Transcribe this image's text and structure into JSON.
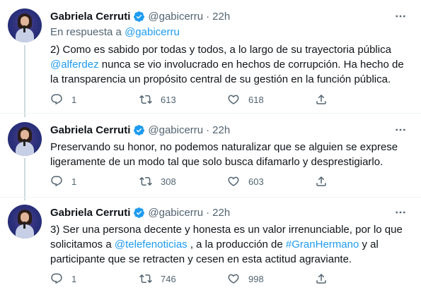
{
  "author": {
    "name": "Gabriela Cerruti",
    "handle": "@gabicerru",
    "time": "22h"
  },
  "colors": {
    "link": "#1d9bf0",
    "muted": "#536471",
    "verified": "#1d9bf0"
  },
  "tweets": [
    {
      "reply_prefix": "En respuesta a ",
      "reply_handle": "@gabicerru",
      "text_a": "2) Como es sabido por todas y todos, a lo largo de su trayectoria pública",
      "mention": "@alferdez",
      "text_b": " nunca se vio involucrado en hechos de corrupción. Ha hecho de la transparencia un propósito central de su gestión en la función pública.",
      "replies": "1",
      "retweets": "613",
      "likes": "618"
    },
    {
      "text": "Preservando su honor, no podemos naturalizar que se alguien se exprese ligeramente de un modo tal que solo busca difamarlo y desprestigiarlo.",
      "replies": "1",
      "retweets": "308",
      "likes": "603"
    },
    {
      "text_a": "3) Ser una persona decente y honesta es un valor irrenunciable, por lo que solicitamos a ",
      "mention": "@telefenoticias",
      "text_b": " , a la producción de ",
      "hashtag": "#GranHermano",
      "text_c": " y al participante que se retracten y cesen en esta actitud agraviante.",
      "replies": "1",
      "retweets": "746",
      "likes": "998"
    }
  ],
  "icons": {
    "verified": "verified-badge-icon",
    "more": "more-icon",
    "reply": "reply-icon",
    "retweet": "retweet-icon",
    "like": "like-icon",
    "share": "share-icon"
  }
}
